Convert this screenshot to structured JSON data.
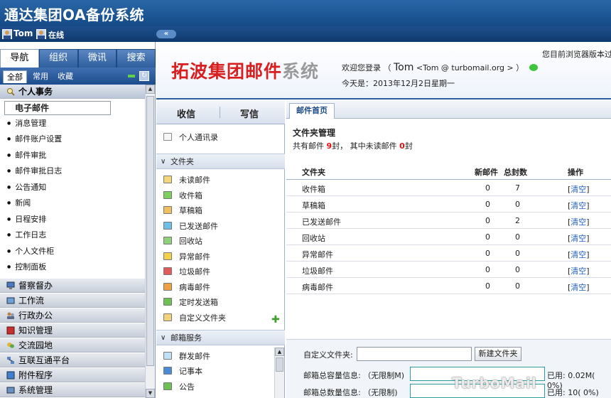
{
  "title_bar": {
    "title": "通达集团OA备份系统"
  },
  "user_bar": {
    "user": "Tom",
    "status": "在线",
    "collapse": "«"
  },
  "left_nav": {
    "tabs": [
      "导航",
      "组织",
      "微讯",
      "搜索"
    ],
    "subtabs": [
      "全部",
      "常用",
      "收藏"
    ],
    "refresh": "↻",
    "open_group": "个人事务",
    "active_item": "电子邮件",
    "items": [
      "消息管理",
      "邮件账户设置",
      "邮件审批",
      "邮件审批日志",
      "公告通知",
      "新闻",
      "日程安排",
      "工作日志",
      "个人文件柜",
      "控制面板"
    ],
    "groups": [
      "督察督办",
      "工作流",
      "行政办公",
      "知识管理",
      "交流园地",
      "互联互通平台",
      "附件程序",
      "系统管理"
    ]
  },
  "header": {
    "logo_red": "拓波集团邮件",
    "logo_grey": "系统",
    "welcome_prefix": "欢迎您登录 （",
    "welcome_name": "Tom",
    "welcome_email": "<Tom @ turbomail.org >",
    "welcome_suffix": "）",
    "today": "今天是：2013年12月2日星期一",
    "browser_note": "您目前浏览器版本过"
  },
  "mail_nav": {
    "inbox": "收信",
    "compose": "写信",
    "contacts": "个人通讯录",
    "folders_section": "文件夹",
    "folders": [
      "未读邮件",
      "收件箱",
      "草稿箱",
      "已发送邮件",
      "回收站",
      "异常邮件",
      "垃圾邮件",
      "病毒邮件",
      "定时发送箱",
      "自定义文件夹"
    ],
    "services_section": "邮箱服务",
    "services": [
      "群发邮件",
      "记事本",
      "公告"
    ]
  },
  "content": {
    "tab": "邮件首页",
    "fm_title": "文件夹管理",
    "sum_pre": "共有邮件",
    "sum_total": "9",
    "sum_mid": "封， 其中未读邮件",
    "sum_unread": "0",
    "sum_post": "封",
    "table": {
      "headers": [
        "文件夹",
        "新邮件",
        "总封数",
        "操作"
      ],
      "rows": [
        {
          "name": "收件箱",
          "new": "0",
          "total": "7",
          "op": "清空"
        },
        {
          "name": "草稿箱",
          "new": "0",
          "total": "0",
          "op": "清空"
        },
        {
          "name": "已发送邮件",
          "new": "0",
          "total": "2",
          "op": "清空"
        },
        {
          "name": "回收站",
          "new": "0",
          "total": "0",
          "op": "清空"
        },
        {
          "name": "异常邮件",
          "new": "0",
          "total": "0",
          "op": "清空"
        },
        {
          "name": "垃圾邮件",
          "new": "0",
          "total": "0",
          "op": "清空"
        },
        {
          "name": "病毒邮件",
          "new": "0",
          "total": "0",
          "op": "清空"
        }
      ]
    },
    "custom_folder_label": "自定义文件夹:",
    "new_folder_btn": "新建文件夹",
    "capacity_label": "邮箱总容量信息: （无限制M)",
    "capacity_used": "已用: 0.02M( 0%)",
    "count_label": "邮箱总数量信息: （无限制)",
    "count_used": "已用: 10( 0%)",
    "watermark": "TurboMail"
  },
  "colors": {
    "title_bg": "#1f5a9a",
    "logo_red": "#d81e1e",
    "logo_grey": "#9a9a9a",
    "alert_red": "#e01010",
    "link_blue": "#1f5fbf"
  }
}
